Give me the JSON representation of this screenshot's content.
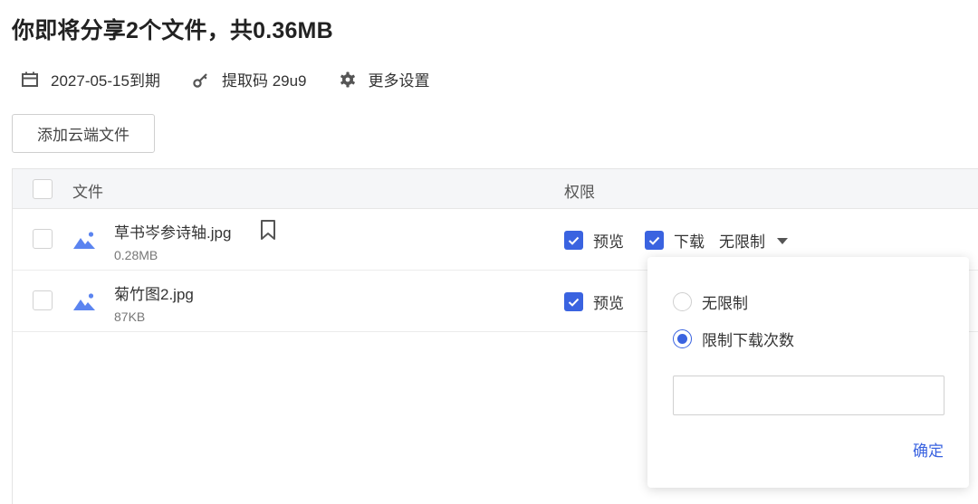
{
  "header": {
    "title": "你即将分享2个文件，共0.36MB"
  },
  "meta": {
    "expiry": {
      "icon": "calendar-icon",
      "text": "2027-05-15到期"
    },
    "code": {
      "icon": "key-icon",
      "text": "提取码 29u9"
    },
    "settings": {
      "icon": "gear-icon",
      "text": "更多设置"
    }
  },
  "toolbar": {
    "add_label": "添加云端文件"
  },
  "table": {
    "columns": {
      "file": "文件",
      "permission": "权限"
    },
    "rows": [
      {
        "name": "草书岑参诗轴.jpg",
        "size": "0.28MB",
        "preview": "预览",
        "download": "下载",
        "limit": "无限制"
      },
      {
        "name": "菊竹图2.jpg",
        "size": "87KB",
        "preview": "预览"
      }
    ]
  },
  "popup": {
    "option_unlimited": "无限制",
    "option_limit": "限制下载次数",
    "input_value": "",
    "confirm_label": "确定"
  },
  "colors": {
    "accent": "#3a63e0",
    "file_icon": "#5b84f0"
  }
}
